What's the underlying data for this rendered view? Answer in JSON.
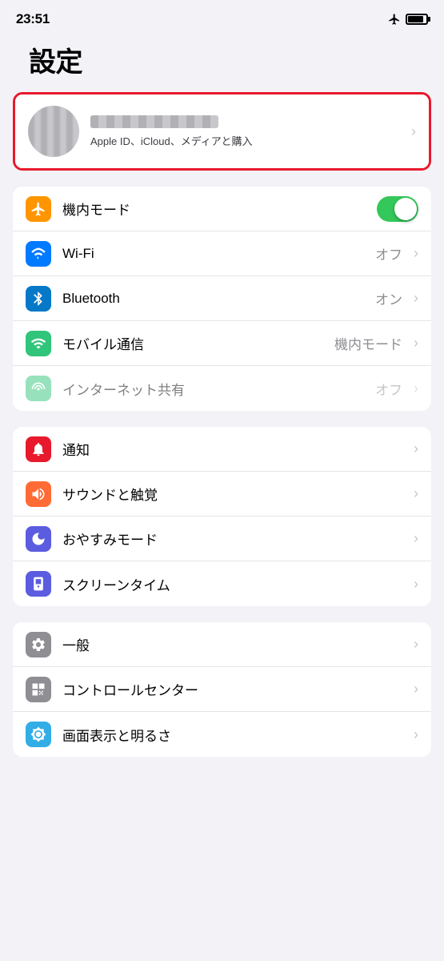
{
  "statusBar": {
    "time": "23:51",
    "signal": "↗"
  },
  "pageTitle": "設定",
  "appleId": {
    "subtitle": "Apple ID、iCloud、メディアと購入"
  },
  "groups": [
    {
      "id": "network",
      "rows": [
        {
          "id": "airplane",
          "label": "機内モード",
          "icon": "airplane",
          "iconBg": "icon-orange",
          "hasToggle": true,
          "toggleOn": true,
          "value": "",
          "hasChevron": false,
          "disabled": false
        },
        {
          "id": "wifi",
          "label": "Wi-Fi",
          "icon": "wifi",
          "iconBg": "icon-blue",
          "hasToggle": false,
          "toggleOn": false,
          "value": "オフ",
          "hasChevron": true,
          "disabled": false
        },
        {
          "id": "bluetooth",
          "label": "Bluetooth",
          "icon": "bluetooth",
          "iconBg": "icon-blue-dark",
          "hasToggle": false,
          "toggleOn": false,
          "value": "オン",
          "hasChevron": true,
          "disabled": false
        },
        {
          "id": "cellular",
          "label": "モバイル通信",
          "icon": "cellular",
          "iconBg": "icon-green-teal",
          "hasToggle": false,
          "toggleOn": false,
          "value": "機内モード",
          "hasChevron": true,
          "disabled": false
        },
        {
          "id": "hotspot",
          "label": "インターネット共有",
          "icon": "hotspot",
          "iconBg": "icon-green-teal",
          "hasToggle": false,
          "toggleOn": false,
          "value": "オフ",
          "hasChevron": true,
          "disabled": true
        }
      ]
    },
    {
      "id": "notifications",
      "rows": [
        {
          "id": "notifications",
          "label": "通知",
          "icon": "notifications",
          "iconBg": "icon-red",
          "hasToggle": false,
          "value": "",
          "hasChevron": true,
          "disabled": false
        },
        {
          "id": "sounds",
          "label": "サウンドと触覚",
          "icon": "sounds",
          "iconBg": "icon-orange-red",
          "hasToggle": false,
          "value": "",
          "hasChevron": true,
          "disabled": false
        },
        {
          "id": "donotdisturb",
          "label": "おやすみモード",
          "icon": "moon",
          "iconBg": "icon-indigo",
          "hasToggle": false,
          "value": "",
          "hasChevron": true,
          "disabled": false
        },
        {
          "id": "screentime",
          "label": "スクリーンタイム",
          "icon": "screentime",
          "iconBg": "icon-indigo",
          "hasToggle": false,
          "value": "",
          "hasChevron": true,
          "disabled": false
        }
      ]
    },
    {
      "id": "general",
      "rows": [
        {
          "id": "general",
          "label": "一般",
          "icon": "gear",
          "iconBg": "icon-gray",
          "hasToggle": false,
          "value": "",
          "hasChevron": true,
          "disabled": false
        },
        {
          "id": "controlcenter",
          "label": "コントロールセンター",
          "icon": "controlcenter",
          "iconBg": "icon-gray",
          "hasToggle": false,
          "value": "",
          "hasChevron": true,
          "disabled": false
        },
        {
          "id": "display",
          "label": "画面表示と明るさ",
          "icon": "display",
          "iconBg": "icon-teal",
          "hasToggle": false,
          "value": "",
          "hasChevron": true,
          "disabled": false
        }
      ]
    }
  ]
}
